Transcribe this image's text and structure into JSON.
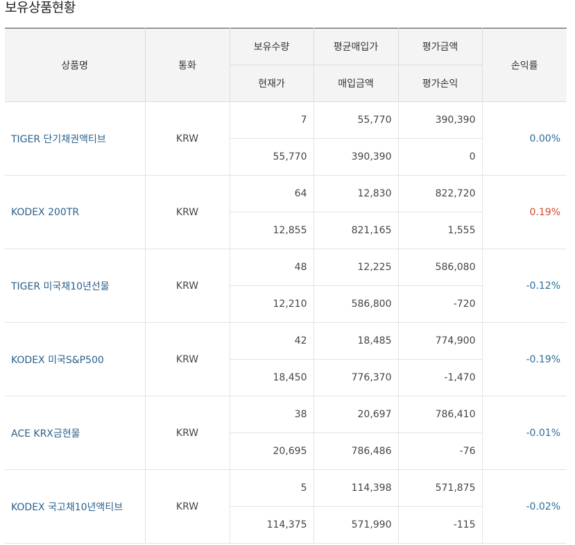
{
  "title": "보유상품현황",
  "headers": {
    "name": "상품명",
    "currency": "통화",
    "quantity": "보유수량",
    "avg_price": "평균매입가",
    "eval_amount": "평가금액",
    "current_price": "현재가",
    "purchase_amount": "매입금액",
    "eval_pnl": "평가손익",
    "return_rate": "손익률"
  },
  "colors": {
    "positive": "#d2482a",
    "negative": "#2a6b96",
    "link": "#2a5f8a"
  },
  "rows": [
    {
      "name": "TIGER 단기채권액티브",
      "currency": "KRW",
      "quantity": "7",
      "avg_price": "55,770",
      "eval_amount": "390,390",
      "current_price": "55,770",
      "purchase_amount": "390,390",
      "eval_pnl": "0",
      "return_rate": "0.00%",
      "sign": "zero"
    },
    {
      "name": "KODEX 200TR",
      "currency": "KRW",
      "quantity": "64",
      "avg_price": "12,830",
      "eval_amount": "822,720",
      "current_price": "12,855",
      "purchase_amount": "821,165",
      "eval_pnl": "1,555",
      "return_rate": "0.19%",
      "sign": "pos"
    },
    {
      "name": "TIGER 미국채10년선물",
      "currency": "KRW",
      "quantity": "48",
      "avg_price": "12,225",
      "eval_amount": "586,080",
      "current_price": "12,210",
      "purchase_amount": "586,800",
      "eval_pnl": "-720",
      "return_rate": "-0.12%",
      "sign": "neg"
    },
    {
      "name": "KODEX 미국S&P500",
      "currency": "KRW",
      "quantity": "42",
      "avg_price": "18,485",
      "eval_amount": "774,900",
      "current_price": "18,450",
      "purchase_amount": "776,370",
      "eval_pnl": "-1,470",
      "return_rate": "-0.19%",
      "sign": "neg"
    },
    {
      "name": "ACE KRX금현물",
      "currency": "KRW",
      "quantity": "38",
      "avg_price": "20,697",
      "eval_amount": "786,410",
      "current_price": "20,695",
      "purchase_amount": "786,486",
      "eval_pnl": "-76",
      "return_rate": "-0.01%",
      "sign": "neg"
    },
    {
      "name": "KODEX 국고채10년액티브",
      "currency": "KRW",
      "quantity": "5",
      "avg_price": "114,398",
      "eval_amount": "571,875",
      "current_price": "114,375",
      "purchase_amount": "571,990",
      "eval_pnl": "-115",
      "return_rate": "-0.02%",
      "sign": "neg"
    }
  ]
}
